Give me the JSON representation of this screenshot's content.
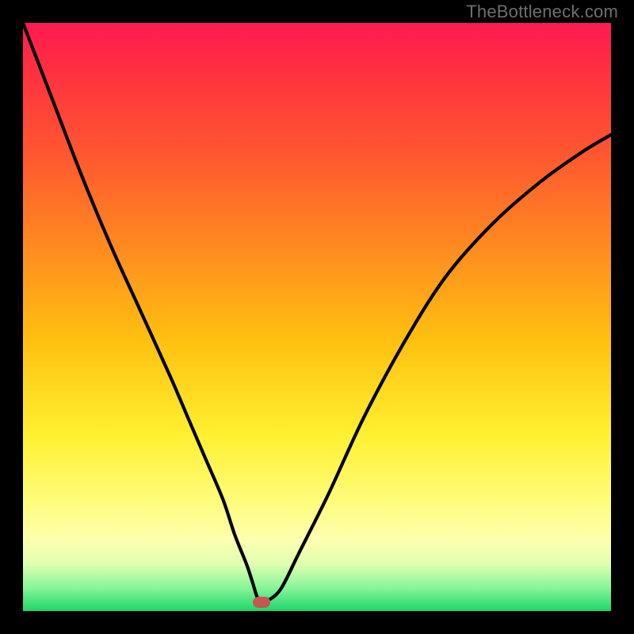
{
  "watermark": "TheBottleneck.com",
  "colors": {
    "curve": "#000000",
    "marker": "#c6574f",
    "frame_bg": "#000000"
  },
  "chart_data": {
    "type": "line",
    "title": "",
    "xlabel": "",
    "ylabel": "",
    "xlim": [
      0,
      100
    ],
    "ylim": [
      0,
      100
    ],
    "grid": false,
    "legend": false,
    "annotations": [
      {
        "kind": "marker",
        "x": 40.5,
        "y": 1.5,
        "shape": "pill",
        "color": "#c6574f"
      }
    ],
    "series": [
      {
        "name": "bottleneck-curve",
        "color": "#000000",
        "x": [
          0,
          5,
          10,
          15,
          20,
          25,
          28,
          31,
          34,
          36,
          38,
          39,
          40,
          41,
          42,
          44,
          47,
          52,
          58,
          65,
          72,
          80,
          88,
          95,
          100
        ],
        "y": [
          100,
          87,
          74,
          62,
          51,
          40,
          33,
          26,
          19,
          13,
          8,
          5,
          2,
          2,
          2,
          4,
          10,
          20,
          33,
          46,
          57,
          66,
          73,
          78,
          81
        ]
      }
    ]
  }
}
